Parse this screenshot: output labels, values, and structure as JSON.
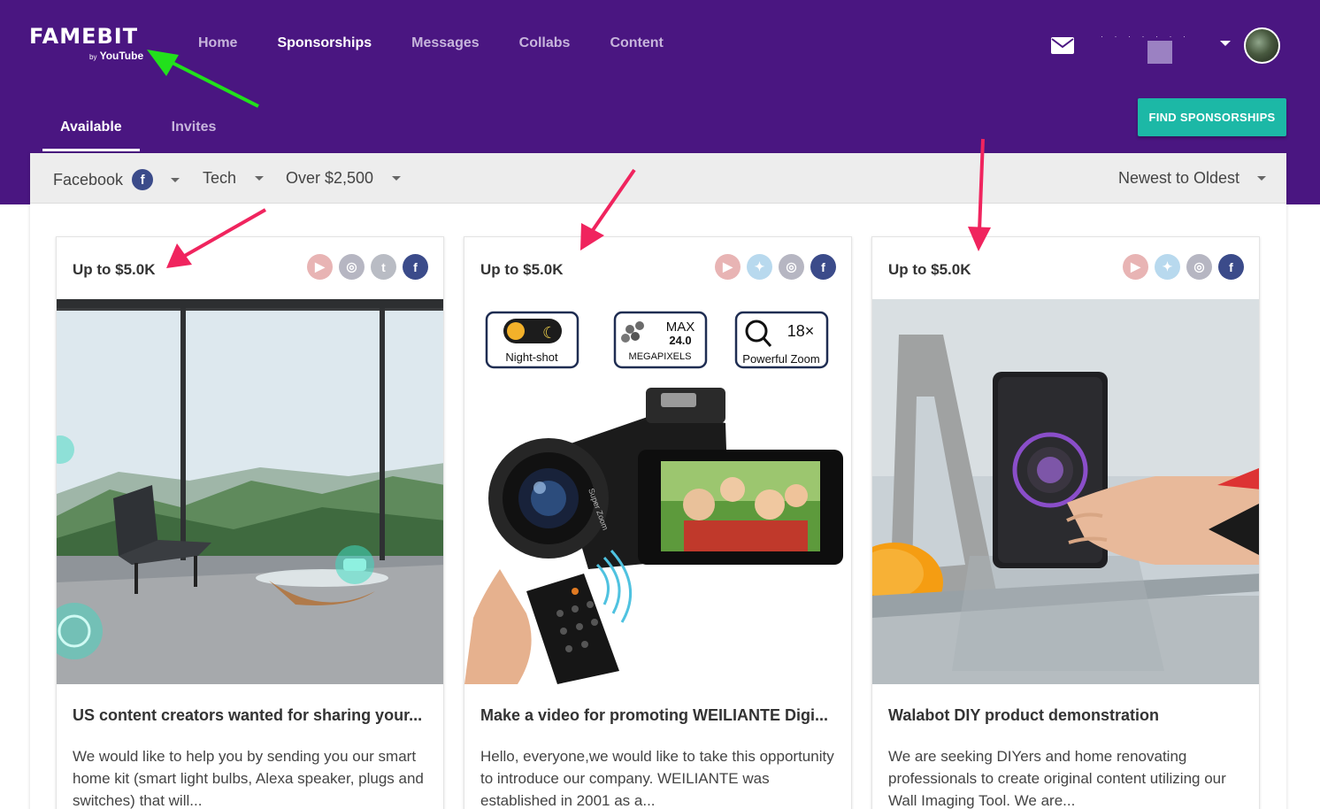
{
  "brand": {
    "name": "FAMEBIT",
    "by": "by",
    "sub": "YouTube"
  },
  "nav": [
    "Home",
    "Sponsorships",
    "Messages",
    "Collabs",
    "Content"
  ],
  "nav_active": "Sponsorships",
  "user": {
    "name": "· · · · · · · ·"
  },
  "tabs": [
    "Available",
    "Invites"
  ],
  "find_button": "FIND SPONSORSHIPS",
  "filters": {
    "platform": "Facebook",
    "platform_icon": "f",
    "category": "Tech",
    "budget": "Over $2,500",
    "sort": "Newest to Oldest"
  },
  "cards": [
    {
      "price": "Up to $5.0K",
      "platforms": [
        "youtube",
        "instagram",
        "tumblr",
        "facebook"
      ],
      "title": "US content creators wanted for sharing your...",
      "description": "We would like to help you by sending you our smart home kit (smart light bulbs, Alexa speaker, plugs and switches) that will..."
    },
    {
      "price": "Up to $5.0K",
      "platforms": [
        "youtube",
        "twitter",
        "instagram",
        "facebook"
      ],
      "title": "Make a video for promoting WEILIANTE Digi...",
      "description": "Hello, everyone,we would like to take this opportunity to introduce our company. WEILIANTE was established in 2001 as a...",
      "image_labels": {
        "night": "Night-shot",
        "max": "MAX",
        "mp_value": "24.0",
        "mp": "MEGAPIXELS",
        "zoom_value": "18×",
        "zoom": "Powerful Zoom",
        "lens": "Super Zoom"
      }
    },
    {
      "price": "Up to $5.0K",
      "platforms": [
        "youtube",
        "twitter",
        "instagram",
        "facebook"
      ],
      "title": "Walabot DIY product demonstration",
      "description": "We are seeking DIYers and home renovating professionals to create original content utilizing our Wall Imaging Tool. We are..."
    }
  ],
  "annotation_colors": {
    "green": "#22e01c",
    "pink": "#f0245e"
  }
}
